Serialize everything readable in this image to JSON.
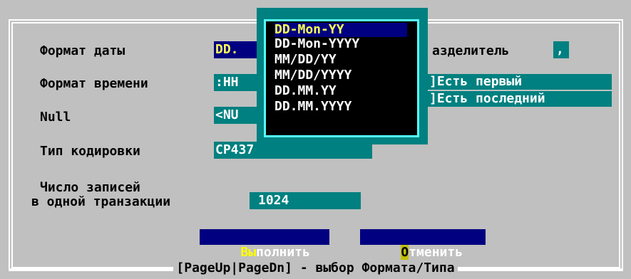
{
  "labels": {
    "date_format": "Формат даты",
    "time_format": "Формат времени",
    "null": "Null",
    "encoding": "Тип кодировки",
    "records_line1": "Число записей",
    "records_line2": "в одной транзакции",
    "separator": "азделитель"
  },
  "fields": {
    "date_value": "DD.",
    "time_value": ":HH",
    "null_value": "<NU",
    "encoding_value": "CP437",
    "records_value": "1024",
    "separator_value": ","
  },
  "checkboxes": {
    "first_label": "]Есть первый",
    "last_label": "]Есть последний"
  },
  "buttons": {
    "execute_hot": "Вы",
    "execute_rest": "полнить",
    "cancel_hot": "О",
    "cancel_rest": "тменить"
  },
  "popup_items": [
    "DD-Mon-YY",
    "DD-Mon-YYYY",
    "MM/DD/YY",
    "MM/DD/YYYY",
    "DD.MM.YY",
    "DD.MM.YYYY"
  ],
  "popup_selected_index": 0,
  "status": "[PageUp|PageDn] - выбор Формата/Типа"
}
